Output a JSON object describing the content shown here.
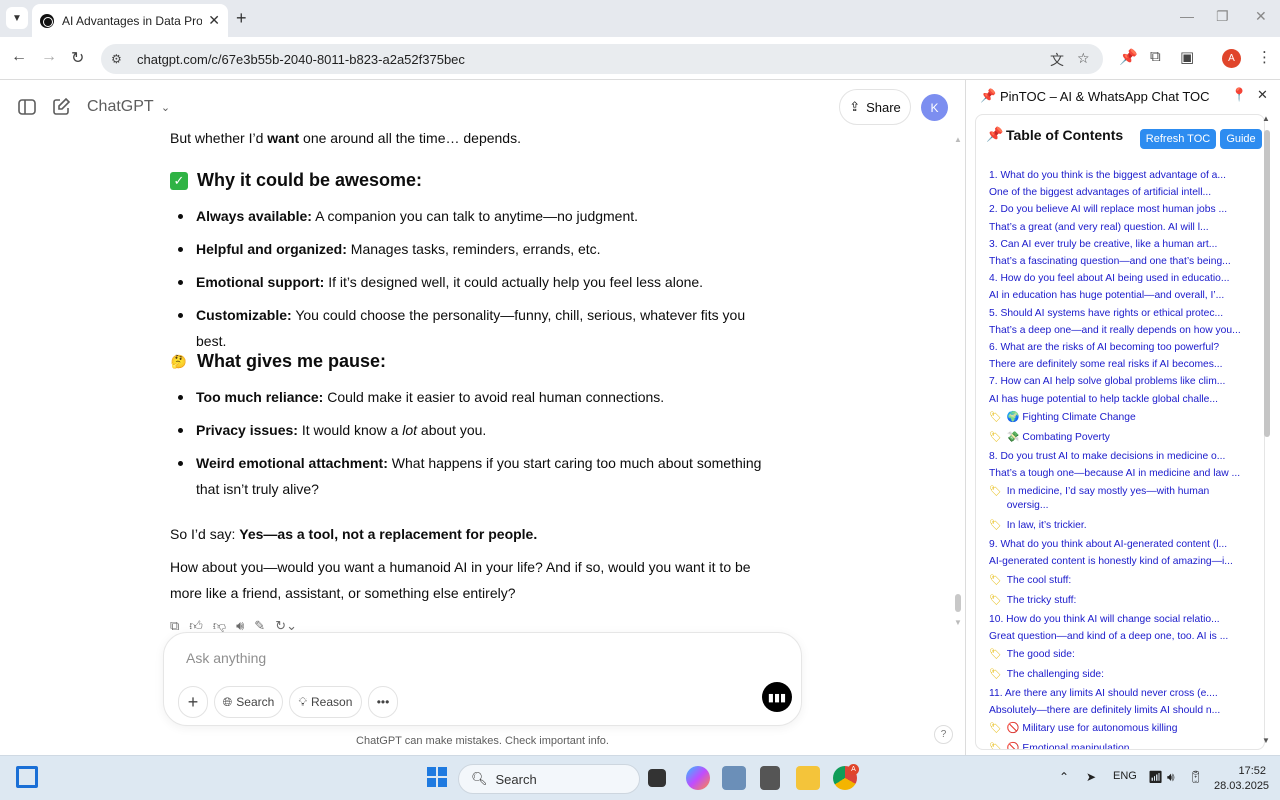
{
  "browser": {
    "tab_title": "AI Advantages in Data Processi",
    "url": "chatgpt.com/c/67e3b55b-2040-8011-b823-a2a52f375bec",
    "profile_initial": "A"
  },
  "chat": {
    "brand": "ChatGPT",
    "share_label": "Share",
    "avatar_initial": "K",
    "intro_prefix": "But whether I’d ",
    "intro_bold": "want",
    "intro_suffix": " one around all the time… depends.",
    "section1": {
      "emoji": "✅",
      "heading": "Why it could be awesome:",
      "items": [
        {
          "bold": "Always available:",
          "text": " A companion you can talk to anytime—no judgment."
        },
        {
          "bold": "Helpful and organized:",
          "text": " Manages tasks, reminders, errands, etc."
        },
        {
          "bold": "Emotional support:",
          "text": " If it’s designed well, it could actually help you feel less alone."
        },
        {
          "bold": "Customizable:",
          "text": " You could choose the personality—funny, chill, serious, whatever fits you best."
        }
      ]
    },
    "section2": {
      "emoji": "🤔",
      "heading": "What gives me pause:",
      "items": [
        {
          "bold": "Too much reliance:",
          "text": " Could make it easier to avoid real human connections."
        },
        {
          "bold": "Privacy issues:",
          "text": " It would know a ",
          "italic": "lot",
          "text2": " about you."
        },
        {
          "bold": "Weird emotional attachment:",
          "text": " What happens if you start caring too much about something that isn’t truly alive?"
        }
      ]
    },
    "conclusion_prefix": "So I’d say: ",
    "conclusion_bold": "Yes—as a tool, not a replacement for people.",
    "question": "How about you—would you want a humanoid AI in your life? And if so, would you want it to be more like a friend, assistant, or something else entirely?",
    "composer": {
      "placeholder": "Ask anything",
      "search_label": "Search",
      "reason_label": "Reason"
    },
    "disclaimer": "ChatGPT can make mistakes. Check important info.",
    "help": "?"
  },
  "panel": {
    "title": "PinTOC – AI & WhatsApp Chat TOC",
    "toc_title": "Table of Contents",
    "refresh_label": "Refresh TOC",
    "guide_label": "Guide",
    "entries": [
      {
        "type": "q",
        "text": "1. What do you think is the biggest advantage of a..."
      },
      {
        "type": "a",
        "text": "One of the biggest advantages of artificial intell..."
      },
      {
        "type": "q",
        "text": "2. Do you believe AI will replace most human jobs ..."
      },
      {
        "type": "a",
        "text": "That’s a great (and very real) question. AI will l..."
      },
      {
        "type": "q",
        "text": "3. Can AI ever truly be creative, like a human art..."
      },
      {
        "type": "a",
        "text": "That’s a fascinating question—and one that’s being..."
      },
      {
        "type": "q",
        "text": "4. How do you feel about AI being used in educatio..."
      },
      {
        "type": "a",
        "text": "AI in education has huge potential—and overall, I’..."
      },
      {
        "type": "q",
        "text": "5. Should AI systems have rights or ethical protec..."
      },
      {
        "type": "a",
        "text": "That’s a deep one—and it really depends on how you..."
      },
      {
        "type": "q",
        "text": "6. What are the risks of AI becoming too powerful?"
      },
      {
        "type": "a",
        "text": "There are definitely some real risks if AI becomes..."
      },
      {
        "type": "q",
        "text": "7. How can AI help solve global problems like clim..."
      },
      {
        "type": "a",
        "text": "AI has huge potential to help tackle global challe..."
      },
      {
        "type": "s",
        "text": "🌍 Fighting Climate Change"
      },
      {
        "type": "s",
        "text": "💸 Combating Poverty"
      },
      {
        "type": "q",
        "text": "8. Do you trust AI to make decisions in medicine o..."
      },
      {
        "type": "a",
        "text": "That’s a tough one—because AI in medicine and law ..."
      },
      {
        "type": "s",
        "text": "In medicine, I’d say mostly yes—with human oversig..."
      },
      {
        "type": "s",
        "text": "In law, it’s trickier."
      },
      {
        "type": "q",
        "text": "9. What do you think about AI-generated content (l..."
      },
      {
        "type": "a",
        "text": "AI-generated content is honestly kind of amazing—i..."
      },
      {
        "type": "s",
        "text": "The cool stuff:"
      },
      {
        "type": "s",
        "text": "The tricky stuff:"
      },
      {
        "type": "q",
        "text": "10. How do you think AI will change social relatio..."
      },
      {
        "type": "a",
        "text": "Great question—and kind of a deep one, too. AI is ..."
      },
      {
        "type": "s",
        "text": "The good side:"
      },
      {
        "type": "s",
        "text": "The challenging side:"
      },
      {
        "type": "q",
        "text": "11. Are there any limits AI should never cross (e...."
      },
      {
        "type": "a",
        "text": "Absolutely—there are definitely limits AI should n..."
      },
      {
        "type": "s",
        "text": "🚫 Military use for autonomous killing"
      },
      {
        "type": "s",
        "text": "🚫 Emotional manipulation"
      }
    ]
  },
  "taskbar": {
    "search_label": "Search",
    "lang": "ENG",
    "time": "17:52",
    "date": "28.03.2025",
    "chrome_badge": "A"
  }
}
